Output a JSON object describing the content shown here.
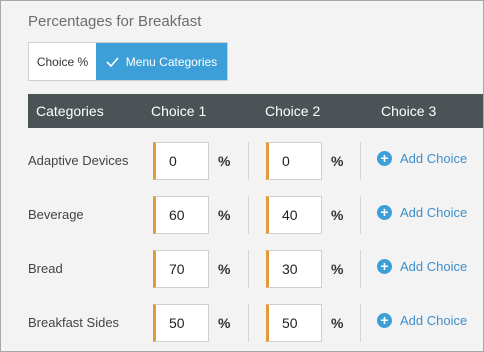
{
  "title": "Percentages for Breakfast",
  "toggle": {
    "choice_label": "Choice %",
    "menu_label": "Menu Categories"
  },
  "table": {
    "headers": [
      "Categories",
      "Choice 1",
      "Choice 2",
      "Choice 3"
    ],
    "percent_symbol": "%",
    "add_choice_label": "Add Choice",
    "rows": [
      {
        "category": "Adaptive Devices",
        "choice1": "0",
        "choice2": "0"
      },
      {
        "category": "Beverage",
        "choice1": "60",
        "choice2": "40"
      },
      {
        "category": "Bread",
        "choice1": "70",
        "choice2": "30"
      },
      {
        "category": "Breakfast Sides",
        "choice1": "50",
        "choice2": "50"
      }
    ]
  },
  "colors": {
    "accent": "#3d9fd7",
    "header_bg": "#4b5357",
    "input_border_accent": "#e39a3b"
  }
}
